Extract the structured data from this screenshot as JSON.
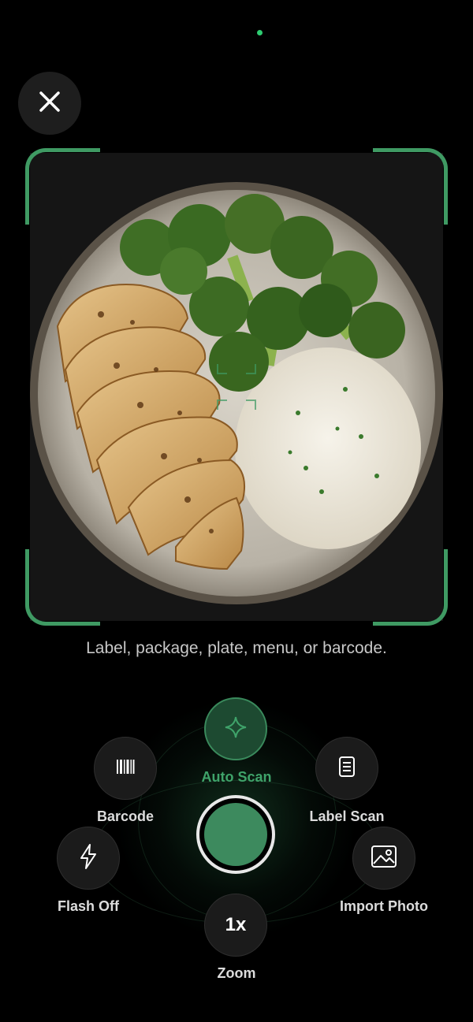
{
  "header": {
    "close_icon": "close-icon",
    "status_indicator_color": "#2ecc71"
  },
  "viewfinder": {
    "frame_color": "#3f9a63",
    "photo_subject": "plate-photo"
  },
  "hint": {
    "text": "Label, package, plate, menu, or barcode."
  },
  "controls": {
    "auto_scan": {
      "label": "Auto Scan",
      "icon": "sparkle-icon",
      "accent": "#3fa36a"
    },
    "barcode": {
      "label": "Barcode",
      "icon": "barcode-icon"
    },
    "label_scan": {
      "label": "Label Scan",
      "icon": "document-icon"
    },
    "flash": {
      "label": "Flash Off",
      "icon": "lightning-icon"
    },
    "import_photo": {
      "label": "Import Photo",
      "icon": "image-icon"
    },
    "zoom": {
      "label": "Zoom",
      "value": "1x"
    },
    "shutter": {
      "color": "#3d8a5e"
    }
  }
}
